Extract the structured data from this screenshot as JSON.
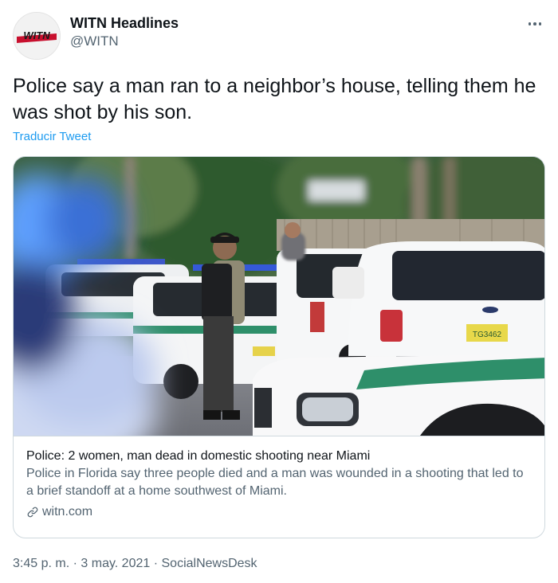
{
  "author": {
    "display_name": "WITN Headlines",
    "handle": "@WITN",
    "avatar_logo_text": "WITN"
  },
  "tweet": {
    "text": "Police say a man ran to a neighbor’s house, telling them he was shot by his son.",
    "translate_label": "Traducir Tweet"
  },
  "link_card": {
    "title": "Police: 2 women, man dead in domestic shooting near Miami",
    "description": "Police in Florida say three people died and a man was wounded in a shooting that led to a brief standoff at a home southwest of Miami.",
    "domain": "witn.com",
    "license_plate_text": "TG3462"
  },
  "meta": {
    "time": "3:45 p. m.",
    "separator": "·",
    "date": "3 may. 2021",
    "source": "SocialNewsDesk"
  },
  "icons": {
    "more": "more-horizontal-icon",
    "link": "link-icon"
  },
  "colors": {
    "link_blue": "#1d9bf0",
    "secondary_text": "#536471",
    "border": "#cfd9de",
    "police_green": "#2e8f6a"
  }
}
